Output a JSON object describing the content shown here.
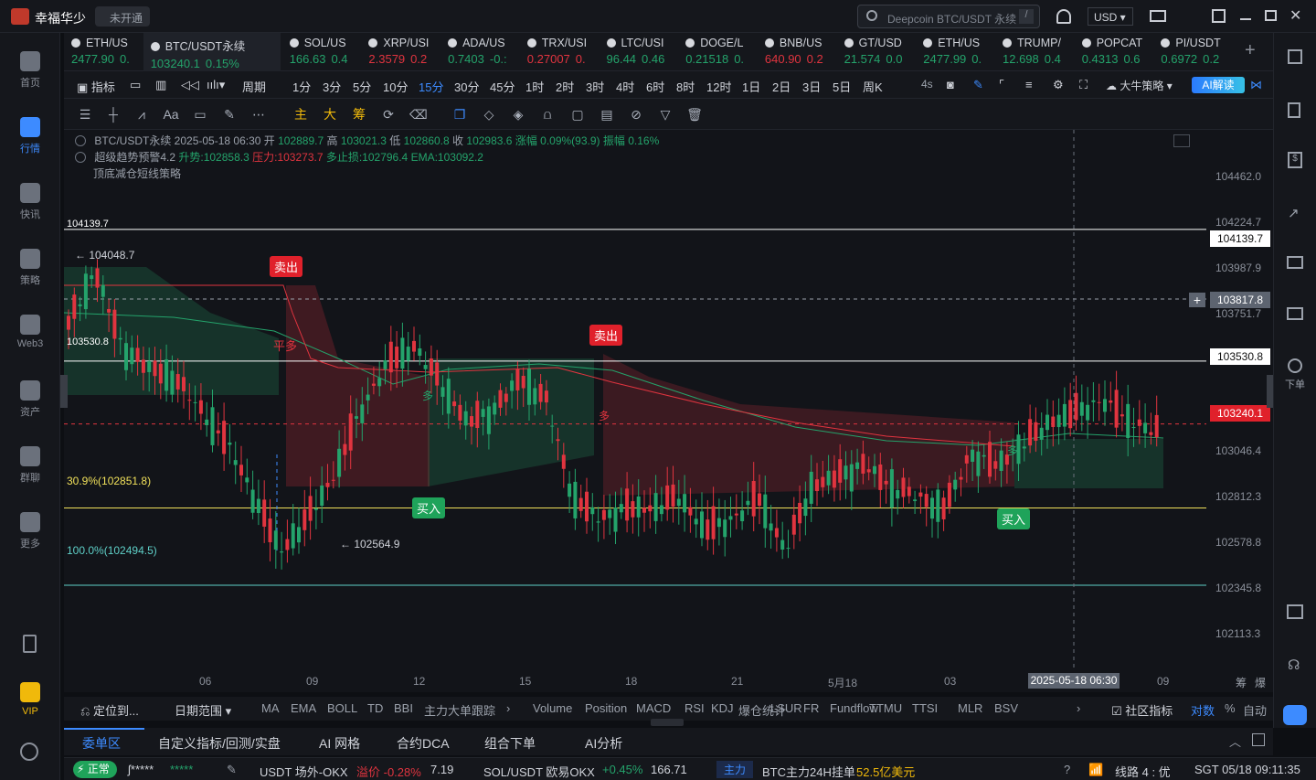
{
  "app": {
    "user": "幸福华少",
    "status": "未开通",
    "search_placeholder": "Deepcoin BTC/USDT 永续",
    "search_shortcut": "/",
    "currency": "USD"
  },
  "leftnav": [
    {
      "label": "首页",
      "icon": "home-icon"
    },
    {
      "label": "行情",
      "icon": "market-icon",
      "active": true
    },
    {
      "label": "快讯",
      "icon": "news-icon"
    },
    {
      "label": "策略",
      "icon": "strategy-icon"
    },
    {
      "label": "Web3",
      "icon": "web3-icon"
    },
    {
      "label": "资产",
      "icon": "assets-icon"
    },
    {
      "label": "群聊",
      "icon": "chat-icon"
    },
    {
      "label": "更多",
      "icon": "more-icon"
    },
    {
      "label": "VIP",
      "icon": "vip-icon"
    }
  ],
  "tickers": [
    {
      "name": "ETH/US",
      "price": "2477.90",
      "chg": "0.",
      "dir": "up"
    },
    {
      "name": "BTC/USDT永续",
      "price": "103240.1",
      "chg": "0.15%",
      "dir": "up",
      "selected": true
    },
    {
      "name": "SOL/US",
      "price": "166.63",
      "chg": "0.4",
      "dir": "up"
    },
    {
      "name": "XRP/USI",
      "price": "2.3579",
      "chg": "0.2",
      "dir": "dn"
    },
    {
      "name": "ADA/US",
      "price": "0.7403",
      "chg": "-0.:",
      "dir": "up"
    },
    {
      "name": "TRX/USI",
      "price": "0.27007",
      "chg": "0.",
      "dir": "dn"
    },
    {
      "name": "LTC/USI",
      "price": "96.44",
      "chg": "0.46",
      "dir": "up"
    },
    {
      "name": "DOGE/L",
      "price": "0.21518",
      "chg": "0.",
      "dir": "up"
    },
    {
      "name": "BNB/US",
      "price": "640.90",
      "chg": "0.2",
      "dir": "dn"
    },
    {
      "name": "GT/USD",
      "price": "21.574",
      "chg": "0.0",
      "dir": "up"
    },
    {
      "name": "ETH/US",
      "price": "2477.99",
      "chg": "0.",
      "dir": "up"
    },
    {
      "name": "TRUMP/",
      "price": "12.698",
      "chg": "0.4",
      "dir": "up"
    },
    {
      "name": "POPCAT",
      "price": "0.4313",
      "chg": "0.6",
      "dir": "up"
    },
    {
      "name": "PI/USDT",
      "price": "0.6972",
      "chg": "0.2",
      "dir": "up"
    }
  ],
  "periods": {
    "indicator": "指标",
    "cycle": "周期",
    "items": [
      "1分",
      "3分",
      "5分",
      "10分",
      "15分",
      "30分",
      "45分",
      "1时",
      "2时",
      "3时",
      "4时",
      "6时",
      "8时",
      "12时",
      "1日",
      "2日",
      "3日",
      "5日",
      "周K"
    ],
    "active": "15分",
    "refresh": "4s",
    "strategy": "大牛策略",
    "ai": "AI解读"
  },
  "drawtools": {
    "labels": [
      "主",
      "大",
      "筹"
    ]
  },
  "chart_info": {
    "line1_prefix": "BTC/USDT永续 2025-05-18 06:30 开",
    "open": "102889.7",
    "high_label": "高",
    "high": "103021.3",
    "low_label": "低",
    "low": "102860.8",
    "close_label": "收",
    "close": "102983.6",
    "change": "涨幅 0.09%(93.9)",
    "amp": "振幅 0.16%",
    "line2_prefix": "超级趋势预警4.2",
    "line2_up": "升势:102858.3",
    "line2_press": "压力:103273.7",
    "line2_stop": "多止损:102796.4",
    "line2_ema": "EMA:103092.2",
    "line3": "顶底减仓短线策略"
  },
  "chart_labels": {
    "l104139": "104139.7",
    "l103530": "103530.8",
    "hi": "← 104048.7",
    "lo": "← 102564.9",
    "fib309": "30.9%(102851.8)",
    "fib100": "100.0%(102494.5)",
    "sell": "卖出",
    "buy": "买入",
    "pingduo": "平多",
    "duo": "多"
  },
  "price_axis": [
    "104462.0",
    "104224.7",
    "103987.9",
    "103751.7",
    "103046.4",
    "102812.3",
    "102578.8",
    "102345.8",
    "102113.3"
  ],
  "price_boxes": {
    "a": "104139.7",
    "b": "103817.8",
    "c": "103530.8",
    "d": "103240.1"
  },
  "time_axis": [
    "06",
    "09",
    "12",
    "15",
    "18",
    "21",
    "5月18",
    "03",
    "09"
  ],
  "crosshair_time": "2025-05-18 06:30",
  "axis_right": [
    "筹",
    "爆"
  ],
  "bottombar": {
    "locate": "定位到...",
    "range": "日期范围",
    "items": [
      "MA",
      "EMA",
      "BOLL",
      "TD",
      "BBI",
      "主力大单跟踪",
      "Volume",
      "Position",
      "MACD",
      "RSI",
      "KDJ",
      "爆仓统计",
      "LSUR",
      "FR",
      "Fundflow",
      "TTMU",
      "TTSI",
      "MLR",
      "BSV"
    ],
    "community": "社区指标",
    "log": "对数",
    "pct": "%",
    "auto": "自动"
  },
  "tabs2": [
    "委单区",
    "自定义指标/回测/实盘",
    "AI 网格",
    "合约DCA",
    "组合下单",
    "AI分析"
  ],
  "statusbar": {
    "status": "正常",
    "user": "ʃ*****",
    "stars": "*****",
    "item1": "USDT 场外-OKX",
    "prem": "溢价 -0.28%",
    "rate": "7.19",
    "item2": "SOL/USDT 欧易OKX",
    "item2_chg": "+0.45%",
    "item2_px": "166.71",
    "tag": "主力",
    "news": "BTC主力24H挂单",
    "news_amt": "52.5亿美元",
    "line": "线路 4 : 优",
    "time": "SGT 05/18 09:11:35"
  },
  "rightnav": {
    "label": "下单"
  },
  "chart_data": {
    "type": "candlestick",
    "y_range": [
      102000,
      104600
    ],
    "level_lines": [
      104139.7,
      103530.8,
      102851.8,
      102494.5
    ],
    "dotted_lines": [
      103817.8,
      103240.1
    ]
  }
}
